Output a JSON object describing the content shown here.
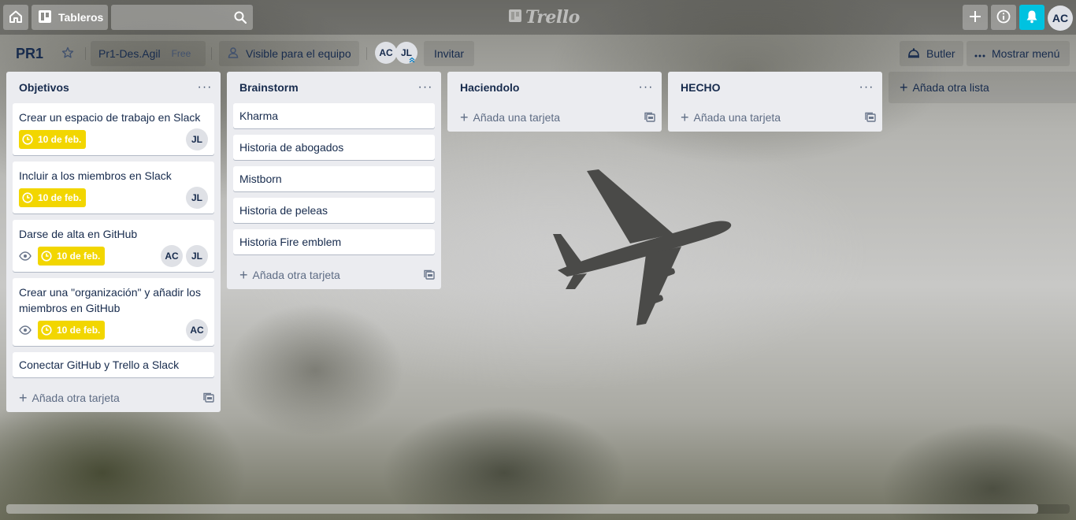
{
  "header": {
    "boards_label": "Tableros",
    "search_value": "",
    "logo_text": "Trello",
    "user_initials": "AC"
  },
  "board": {
    "title": "PR1",
    "team": "Pr1-Des.Agil",
    "team_badge": "Free",
    "visibility": "Visible para el equipo",
    "members": [
      "AC",
      "JL"
    ],
    "invite_label": "Invitar",
    "butler_label": "Butler",
    "menu_label": "Mostrar menú"
  },
  "lists": [
    {
      "name": "Objetivos",
      "cards": [
        {
          "title": "Crear un espacio de trabajo en Slack",
          "due": "10 de feb.",
          "watch": false,
          "members": [
            "JL"
          ]
        },
        {
          "title": "Incluir a los miembros en Slack",
          "due": "10 de feb.",
          "watch": false,
          "members": [
            "JL"
          ]
        },
        {
          "title": "Darse de alta en GitHub",
          "due": "10 de feb.",
          "watch": true,
          "members": [
            "AC",
            "JL"
          ]
        },
        {
          "title": "Crear una \"organización\" y añadir los miembros en GitHub",
          "due": "10 de feb.",
          "watch": true,
          "members": [
            "AC"
          ]
        },
        {
          "title": "Conectar GitHub y Trello a Slack"
        }
      ],
      "add_label": "Añada otra tarjeta"
    },
    {
      "name": "Brainstorm",
      "cards": [
        {
          "title": "Kharma"
        },
        {
          "title": "Historia de abogados"
        },
        {
          "title": "Mistborn"
        },
        {
          "title": "Historia de peleas"
        },
        {
          "title": "Historia Fire emblem"
        }
      ],
      "add_label": "Añada otra tarjeta"
    },
    {
      "name": "Haciendolo",
      "cards": [],
      "add_label": "Añada una tarjeta"
    },
    {
      "name": "HECHO",
      "cards": [],
      "add_label": "Añada una tarjeta"
    }
  ],
  "add_list_label": "Añada otra lista",
  "colors": {
    "due_badge": "#f2d600",
    "notification": "#00c2e0",
    "list_bg": "#ebecf0"
  }
}
